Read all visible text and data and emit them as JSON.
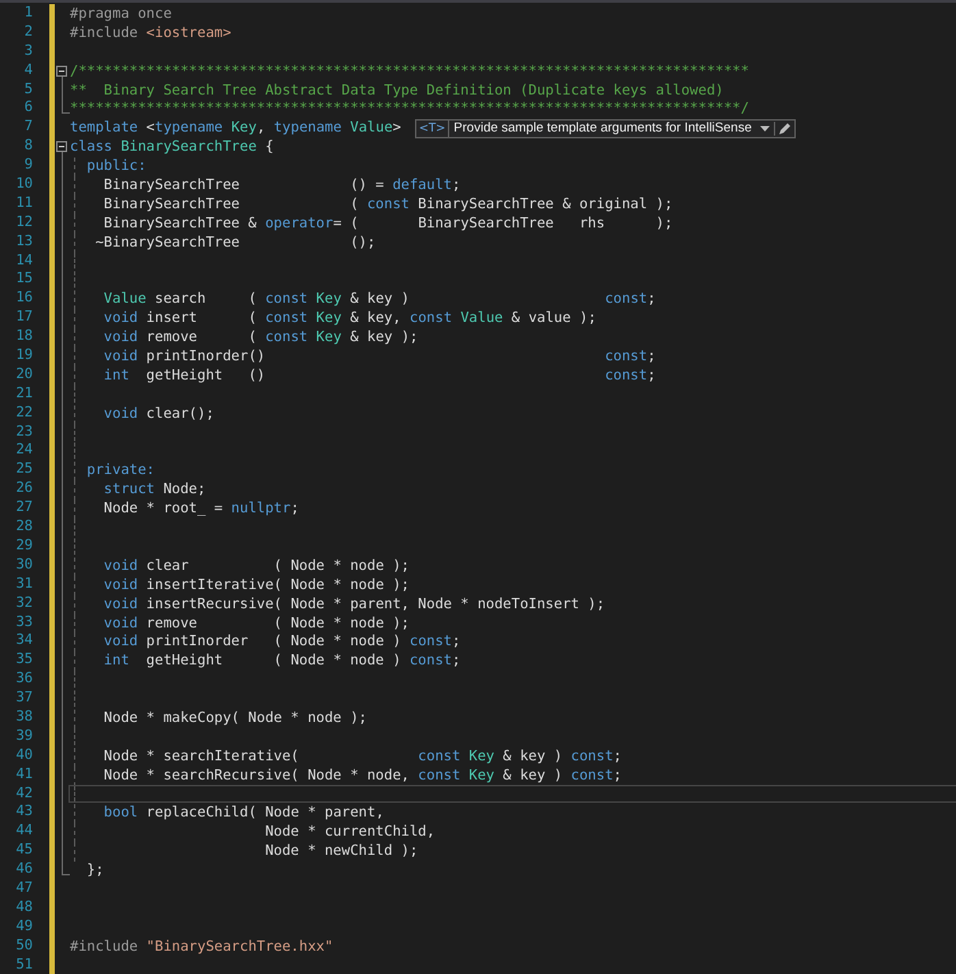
{
  "editor": {
    "lines": [
      {
        "number": "1",
        "changed": true,
        "current": false,
        "tokens": [
          {
            "kind": "pre",
            "text": "#pragma once"
          }
        ]
      },
      {
        "number": "2",
        "changed": true,
        "current": false,
        "tokens": [
          {
            "kind": "pre",
            "text": "#include "
          },
          {
            "kind": "str",
            "text": "<iostream>"
          }
        ]
      },
      {
        "number": "3",
        "changed": true,
        "current": false
      },
      {
        "number": "4",
        "changed": true,
        "current": false,
        "fold": {
          "kind": "start"
        },
        "tokens": [
          {
            "kind": "com",
            "text": "/*******************************************************************************"
          }
        ]
      },
      {
        "number": "5",
        "changed": true,
        "current": false,
        "fold": {
          "kind": "inside"
        },
        "tokens": [
          {
            "kind": "com",
            "text": "**  Binary Search Tree Abstract Data Type Definition (Duplicate keys allowed)"
          }
        ]
      },
      {
        "number": "6",
        "changed": true,
        "current": false,
        "fold": {
          "kind": "end"
        },
        "tokens": [
          {
            "kind": "com",
            "text": "*******************************************************************************/"
          }
        ]
      },
      {
        "number": "7",
        "changed": true,
        "current": false,
        "tokens": [
          {
            "kind": "kw",
            "text": "template"
          },
          {
            "kind": "plain",
            "text": " <"
          },
          {
            "kind": "kw",
            "text": "typename"
          },
          {
            "kind": "type",
            "text": " Key"
          },
          {
            "kind": "plain",
            "text": ", "
          },
          {
            "kind": "kw",
            "text": "typename"
          },
          {
            "kind": "type",
            "text": " Value"
          },
          {
            "kind": "plain",
            "text": ">"
          }
        ],
        "hint": {
          "badge": "<T>",
          "text": "Provide sample template arguments for IntelliSense"
        }
      },
      {
        "number": "8",
        "changed": true,
        "current": false,
        "fold": {
          "kind": "start"
        },
        "tokens": [
          {
            "kind": "kw",
            "text": "class"
          },
          {
            "kind": "type",
            "text": " BinarySearchTree"
          },
          {
            "kind": "plain",
            "text": " {"
          }
        ]
      },
      {
        "number": "9",
        "changed": true,
        "current": false,
        "fold": {
          "kind": "inside"
        },
        "tokens": [
          {
            "kind": "kw",
            "text": "  public:"
          }
        ]
      },
      {
        "number": "10",
        "changed": true,
        "current": false,
        "fold": {
          "kind": "inside"
        },
        "tokens": [
          {
            "kind": "plain",
            "text": "    BinarySearchTree             () = "
          },
          {
            "kind": "kw",
            "text": "default"
          },
          {
            "kind": "plain",
            "text": ";"
          }
        ]
      },
      {
        "number": "11",
        "changed": true,
        "current": false,
        "fold": {
          "kind": "inside"
        },
        "tokens": [
          {
            "kind": "plain",
            "text": "    BinarySearchTree             ( "
          },
          {
            "kind": "kw",
            "text": "const"
          },
          {
            "kind": "plain",
            "text": " BinarySearchTree & original );"
          }
        ]
      },
      {
        "number": "12",
        "changed": true,
        "current": false,
        "fold": {
          "kind": "inside"
        },
        "tokens": [
          {
            "kind": "plain",
            "text": "    BinarySearchTree & "
          },
          {
            "kind": "kw",
            "text": "operator"
          },
          {
            "kind": "plain",
            "text": "= (       BinarySearchTree   rhs      );"
          }
        ]
      },
      {
        "number": "13",
        "changed": true,
        "current": false,
        "fold": {
          "kind": "inside"
        },
        "tokens": [
          {
            "kind": "plain",
            "text": "   ~BinarySearchTree             ();"
          }
        ]
      },
      {
        "number": "14",
        "changed": true,
        "current": false,
        "fold": {
          "kind": "inside"
        }
      },
      {
        "number": "15",
        "changed": true,
        "current": false,
        "fold": {
          "kind": "inside"
        }
      },
      {
        "number": "16",
        "changed": true,
        "current": false,
        "fold": {
          "kind": "inside"
        },
        "tokens": [
          {
            "kind": "type",
            "text": "    Value"
          },
          {
            "kind": "plain",
            "text": " search     ( "
          },
          {
            "kind": "kw",
            "text": "const"
          },
          {
            "kind": "type",
            "text": " Key"
          },
          {
            "kind": "plain",
            "text": " & key )                       "
          },
          {
            "kind": "kw",
            "text": "const"
          },
          {
            "kind": "plain",
            "text": ";"
          }
        ]
      },
      {
        "number": "17",
        "changed": true,
        "current": false,
        "fold": {
          "kind": "inside"
        },
        "tokens": [
          {
            "kind": "kw",
            "text": "    void"
          },
          {
            "kind": "plain",
            "text": " insert      ( "
          },
          {
            "kind": "kw",
            "text": "const"
          },
          {
            "kind": "type",
            "text": " Key"
          },
          {
            "kind": "plain",
            "text": " & key, "
          },
          {
            "kind": "kw",
            "text": "const"
          },
          {
            "kind": "type",
            "text": " Value"
          },
          {
            "kind": "plain",
            "text": " & value );"
          }
        ]
      },
      {
        "number": "18",
        "changed": true,
        "current": false,
        "fold": {
          "kind": "inside"
        },
        "tokens": [
          {
            "kind": "kw",
            "text": "    void"
          },
          {
            "kind": "plain",
            "text": " remove      ( "
          },
          {
            "kind": "kw",
            "text": "const"
          },
          {
            "kind": "type",
            "text": " Key"
          },
          {
            "kind": "plain",
            "text": " & key );"
          }
        ]
      },
      {
        "number": "19",
        "changed": true,
        "current": false,
        "fold": {
          "kind": "inside"
        },
        "tokens": [
          {
            "kind": "kw",
            "text": "    void"
          },
          {
            "kind": "plain",
            "text": " printInorder()                                        "
          },
          {
            "kind": "kw",
            "text": "const"
          },
          {
            "kind": "plain",
            "text": ";"
          }
        ]
      },
      {
        "number": "20",
        "changed": true,
        "current": false,
        "fold": {
          "kind": "inside"
        },
        "tokens": [
          {
            "kind": "kw",
            "text": "    int"
          },
          {
            "kind": "plain",
            "text": "  getHeight   ()                                        "
          },
          {
            "kind": "kw",
            "text": "const"
          },
          {
            "kind": "plain",
            "text": ";"
          }
        ]
      },
      {
        "number": "21",
        "changed": true,
        "current": false,
        "fold": {
          "kind": "inside"
        }
      },
      {
        "number": "22",
        "changed": true,
        "current": false,
        "fold": {
          "kind": "inside"
        },
        "tokens": [
          {
            "kind": "kw",
            "text": "    void"
          },
          {
            "kind": "plain",
            "text": " clear();"
          }
        ]
      },
      {
        "number": "23",
        "changed": true,
        "current": false,
        "fold": {
          "kind": "inside"
        }
      },
      {
        "number": "24",
        "changed": true,
        "current": false,
        "fold": {
          "kind": "inside"
        }
      },
      {
        "number": "25",
        "changed": true,
        "current": false,
        "fold": {
          "kind": "inside"
        },
        "tokens": [
          {
            "kind": "kw",
            "text": "  private:"
          }
        ]
      },
      {
        "number": "26",
        "changed": true,
        "current": false,
        "fold": {
          "kind": "inside"
        },
        "tokens": [
          {
            "kind": "kw",
            "text": "    struct"
          },
          {
            "kind": "plain",
            "text": " Node;"
          }
        ]
      },
      {
        "number": "27",
        "changed": true,
        "current": false,
        "fold": {
          "kind": "inside"
        },
        "tokens": [
          {
            "kind": "plain",
            "text": "    Node * root_ = "
          },
          {
            "kind": "kw",
            "text": "nullptr"
          },
          {
            "kind": "plain",
            "text": ";"
          }
        ]
      },
      {
        "number": "28",
        "changed": true,
        "current": false,
        "fold": {
          "kind": "inside"
        }
      },
      {
        "number": "29",
        "changed": true,
        "current": false,
        "fold": {
          "kind": "inside"
        }
      },
      {
        "number": "30",
        "changed": true,
        "current": false,
        "fold": {
          "kind": "inside"
        },
        "tokens": [
          {
            "kind": "kw",
            "text": "    void"
          },
          {
            "kind": "plain",
            "text": " clear          ( Node * node );"
          }
        ]
      },
      {
        "number": "31",
        "changed": true,
        "current": false,
        "fold": {
          "kind": "inside"
        },
        "tokens": [
          {
            "kind": "kw",
            "text": "    void"
          },
          {
            "kind": "plain",
            "text": " insertIterative( Node * node );"
          }
        ]
      },
      {
        "number": "32",
        "changed": true,
        "current": false,
        "fold": {
          "kind": "inside"
        },
        "tokens": [
          {
            "kind": "kw",
            "text": "    void"
          },
          {
            "kind": "plain",
            "text": " insertRecursive( Node * parent, Node * nodeToInsert );"
          }
        ]
      },
      {
        "number": "33",
        "changed": true,
        "current": false,
        "fold": {
          "kind": "inside"
        },
        "tokens": [
          {
            "kind": "kw",
            "text": "    void"
          },
          {
            "kind": "plain",
            "text": " remove         ( Node * node );"
          }
        ]
      },
      {
        "number": "34",
        "changed": true,
        "current": false,
        "fold": {
          "kind": "inside"
        },
        "tokens": [
          {
            "kind": "kw",
            "text": "    void"
          },
          {
            "kind": "plain",
            "text": " printInorder   ( Node * node ) "
          },
          {
            "kind": "kw",
            "text": "const"
          },
          {
            "kind": "plain",
            "text": ";"
          }
        ]
      },
      {
        "number": "35",
        "changed": true,
        "current": false,
        "fold": {
          "kind": "inside"
        },
        "tokens": [
          {
            "kind": "kw",
            "text": "    int"
          },
          {
            "kind": "plain",
            "text": "  getHeight      ( Node * node ) "
          },
          {
            "kind": "kw",
            "text": "const"
          },
          {
            "kind": "plain",
            "text": ";"
          }
        ]
      },
      {
        "number": "36",
        "changed": true,
        "current": false,
        "fold": {
          "kind": "inside"
        }
      },
      {
        "number": "37",
        "changed": true,
        "current": false,
        "fold": {
          "kind": "inside"
        }
      },
      {
        "number": "38",
        "changed": true,
        "current": false,
        "fold": {
          "kind": "inside"
        },
        "tokens": [
          {
            "kind": "plain",
            "text": "    Node * makeCopy( Node * node );"
          }
        ]
      },
      {
        "number": "39",
        "changed": true,
        "current": false,
        "fold": {
          "kind": "inside"
        }
      },
      {
        "number": "40",
        "changed": true,
        "current": false,
        "fold": {
          "kind": "inside"
        },
        "tokens": [
          {
            "kind": "plain",
            "text": "    Node * searchIterative(              "
          },
          {
            "kind": "kw",
            "text": "const"
          },
          {
            "kind": "type",
            "text": " Key"
          },
          {
            "kind": "plain",
            "text": " & key ) "
          },
          {
            "kind": "kw",
            "text": "const"
          },
          {
            "kind": "plain",
            "text": ";"
          }
        ]
      },
      {
        "number": "41",
        "changed": true,
        "current": false,
        "fold": {
          "kind": "inside"
        },
        "tokens": [
          {
            "kind": "plain",
            "text": "    Node * searchRecursive( Node * node, "
          },
          {
            "kind": "kw",
            "text": "const"
          },
          {
            "kind": "type",
            "text": " Key"
          },
          {
            "kind": "plain",
            "text": " & key ) "
          },
          {
            "kind": "kw",
            "text": "const"
          },
          {
            "kind": "plain",
            "text": ";"
          }
        ]
      },
      {
        "number": "42",
        "changed": true,
        "current": true,
        "fold": {
          "kind": "inside"
        }
      },
      {
        "number": "43",
        "changed": true,
        "current": false,
        "fold": {
          "kind": "inside"
        },
        "tokens": [
          {
            "kind": "kw",
            "text": "    bool"
          },
          {
            "kind": "plain",
            "text": " replaceChild( Node * parent,"
          }
        ]
      },
      {
        "number": "44",
        "changed": true,
        "current": false,
        "fold": {
          "kind": "inside"
        },
        "tokens": [
          {
            "kind": "plain",
            "text": "                       Node * currentChild,"
          }
        ]
      },
      {
        "number": "45",
        "changed": true,
        "current": false,
        "fold": {
          "kind": "inside"
        },
        "tokens": [
          {
            "kind": "plain",
            "text": "                       Node * newChild );"
          }
        ]
      },
      {
        "number": "46",
        "changed": true,
        "current": false,
        "fold": {
          "kind": "end"
        },
        "tokens": [
          {
            "kind": "plain",
            "text": "  };"
          }
        ]
      },
      {
        "number": "47",
        "changed": true,
        "current": false
      },
      {
        "number": "48",
        "changed": true,
        "current": false
      },
      {
        "number": "49",
        "changed": true,
        "current": false
      },
      {
        "number": "50",
        "changed": true,
        "current": false,
        "tokens": [
          {
            "kind": "pre",
            "text": "#include "
          },
          {
            "kind": "str",
            "text": "\"BinarySearchTree.hxx\""
          }
        ]
      },
      {
        "number": "51",
        "changed": true,
        "current": false
      }
    ]
  }
}
